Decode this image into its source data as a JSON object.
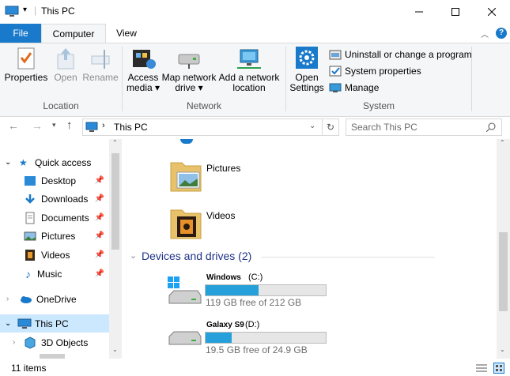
{
  "window": {
    "title": "This PC"
  },
  "ribbon": {
    "tabs": [
      {
        "label": "File"
      },
      {
        "label": "Computer"
      },
      {
        "label": "View"
      }
    ],
    "location": {
      "group_label": "Location",
      "properties": "Properties",
      "open": "Open",
      "rename": "Rename"
    },
    "network": {
      "group_label": "Network",
      "access_media_l1": "Access",
      "access_media_l2": "media ▾",
      "map_drive_l1": "Map network",
      "map_drive_l2": "drive ▾",
      "add_location_l1": "Add a network",
      "add_location_l2": "location"
    },
    "system": {
      "group_label": "System",
      "open_settings_l1": "Open",
      "open_settings_l2": "Settings",
      "uninstall": "Uninstall or change a program",
      "system_properties": "System properties",
      "manage": "Manage"
    }
  },
  "address": {
    "path": "This PC",
    "search_placeholder": "Search This PC"
  },
  "nav": {
    "quick_access": "Quick access",
    "items": [
      {
        "label": "Desktop"
      },
      {
        "label": "Downloads"
      },
      {
        "label": "Documents"
      },
      {
        "label": "Pictures"
      },
      {
        "label": "Videos"
      },
      {
        "label": "Music"
      }
    ],
    "onedrive": "OneDrive",
    "this_pc": "This PC",
    "objects3d": "3D Objects"
  },
  "content": {
    "folders": [
      {
        "label": "Pictures"
      },
      {
        "label": "Videos"
      }
    ],
    "devices_header": "Devices and drives (2)",
    "drives": [
      {
        "name": "Windows",
        "letter": "(C:)",
        "free_text": "119 GB free of 212 GB",
        "used_fraction": 0.44
      },
      {
        "name": "Galaxy S9",
        "letter": "(D:)",
        "free_text": "19.5 GB free of 24.9 GB",
        "used_fraction": 0.22
      }
    ]
  },
  "status": {
    "items": "11 items"
  },
  "colors": {
    "accent": "#1979ca",
    "drive_fill": "#26a0da",
    "nav_selected": "#cce8ff"
  }
}
